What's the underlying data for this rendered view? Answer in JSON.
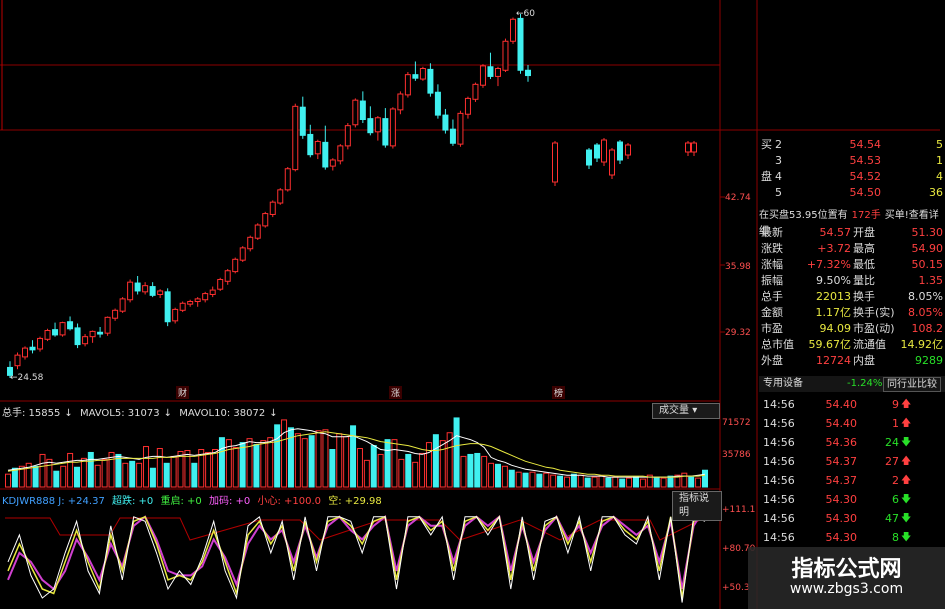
{
  "chart_labels": {
    "peak_price": "60",
    "low_price": "24.58",
    "axis_prices": [
      "42.74",
      "35.98",
      "29.32"
    ],
    "markers": [
      "财",
      "涨",
      "榜"
    ]
  },
  "volume_panel": {
    "header": [
      "总手: 15855",
      "MAVOL5: 31073",
      "MAVOL10: 38072"
    ],
    "button": "成交量",
    "axis": [
      "71572",
      "35786"
    ]
  },
  "indicator_panel": {
    "name": "KDJWR888 J: +24.37",
    "items": [
      "超跌: +0",
      "重启: +0",
      "加码: +0",
      "小心: +100.0",
      "空: +29.98"
    ],
    "button": "指标说明",
    "axis": [
      "+111.1",
      "+80.70",
      "+50.3"
    ]
  },
  "order_book": [
    {
      "side": "买",
      "level": "2",
      "price": "54.54",
      "vol": "5"
    },
    {
      "side": "",
      "level": "3",
      "price": "54.53",
      "vol": "1"
    },
    {
      "side": "盘",
      "level": "4",
      "price": "54.52",
      "vol": "4"
    },
    {
      "side": "",
      "level": "5",
      "price": "54.50",
      "vol": "36"
    }
  ],
  "info_bar": {
    "left": "在买盘53.95位置有",
    "mid": "172手",
    "right": "买单!查看详细"
  },
  "quote": [
    {
      "l1": "最新",
      "v1": "54.57",
      "l2": "开盘",
      "v2": "51.30"
    },
    {
      "l1": "涨跌",
      "v1": "+3.72",
      "l2": "最高",
      "v2": "54.90"
    },
    {
      "l1": "涨幅",
      "v1": "+7.32%",
      "l2": "最低",
      "v2": "50.15"
    },
    {
      "l1": "振幅",
      "v1": "9.50%",
      "l2": "量比",
      "v2": "1.35"
    },
    {
      "l1": "总手",
      "v1": "22013",
      "l2": "换手",
      "v2": "8.05%"
    },
    {
      "l1": "金额",
      "v1": "1.17亿",
      "l2": "换手(实)",
      "v2": "8.05%"
    },
    {
      "l1": "市盈",
      "v1": "94.09",
      "l2": "市盈(动)",
      "v2": "108.2"
    },
    {
      "l1": "总市值",
      "v1": "59.67亿",
      "l2": "流通值",
      "v2": "14.92亿"
    },
    {
      "l1": "外盘",
      "v1": "12724",
      "l2": "内盘",
      "v2": "9289"
    }
  ],
  "sector_bar": {
    "name": "专用设备",
    "change": "-1.24%",
    "button": "同行业比较"
  },
  "ticks": [
    {
      "time": "14:56",
      "price": "54.40",
      "vol": "9",
      "dir": "up"
    },
    {
      "time": "14:56",
      "price": "54.40",
      "vol": "1",
      "dir": "up"
    },
    {
      "time": "14:56",
      "price": "54.36",
      "vol": "24",
      "dir": "down"
    },
    {
      "time": "14:56",
      "price": "54.37",
      "vol": "27",
      "dir": "up"
    },
    {
      "time": "14:56",
      "price": "54.37",
      "vol": "2",
      "dir": "up"
    },
    {
      "time": "14:56",
      "price": "54.30",
      "vol": "6",
      "dir": "down"
    },
    {
      "time": "14:56",
      "price": "54.30",
      "vol": "47",
      "dir": "down"
    },
    {
      "time": "14:56",
      "price": "54.30",
      "vol": "8",
      "dir": "down"
    }
  ],
  "watermark": {
    "title": "指标公式网",
    "url": "www.zbgs3.com"
  },
  "colors": {
    "up": "#ff3030",
    "down": "#40f0f0",
    "grid": "#8b0000",
    "white": "#ffffff",
    "yellow": "#e8e840",
    "magenta": "#d040d0"
  },
  "chart_data": {
    "type": "candlestick",
    "x_label": "",
    "y_label": "",
    "candles": [
      [
        25.8,
        26.5,
        24.6,
        24.9
      ],
      [
        26.0,
        27.5,
        25.6,
        27.2
      ],
      [
        27.0,
        28.2,
        26.7,
        28.0
      ],
      [
        28.1,
        28.9,
        27.4,
        27.8
      ],
      [
        27.9,
        29.3,
        27.6,
        29.1
      ],
      [
        29.0,
        30.2,
        28.8,
        30.0
      ],
      [
        30.1,
        30.9,
        29.3,
        29.5
      ],
      [
        29.5,
        31.0,
        29.3,
        30.9
      ],
      [
        31.0,
        31.6,
        30.0,
        30.2
      ],
      [
        30.3,
        30.8,
        28.0,
        28.4
      ],
      [
        28.5,
        29.6,
        28.2,
        29.3
      ],
      [
        29.3,
        30.0,
        28.6,
        29.9
      ],
      [
        29.8,
        30.4,
        29.2,
        29.6
      ],
      [
        29.7,
        31.6,
        29.4,
        31.5
      ],
      [
        31.4,
        32.5,
        31.1,
        32.3
      ],
      [
        32.2,
        33.8,
        32.0,
        33.6
      ],
      [
        33.5,
        35.8,
        33.2,
        35.5
      ],
      [
        35.4,
        36.2,
        34.1,
        34.5
      ],
      [
        34.4,
        35.5,
        34.1,
        35.1
      ],
      [
        35.0,
        35.5,
        33.8,
        34.0
      ],
      [
        34.1,
        34.7,
        33.7,
        34.5
      ],
      [
        34.4,
        34.8,
        30.5,
        31.0
      ],
      [
        31.1,
        32.6,
        30.8,
        32.4
      ],
      [
        32.3,
        33.3,
        32.1,
        33.1
      ],
      [
        33.0,
        33.5,
        32.7,
        33.3
      ],
      [
        33.3,
        33.8,
        32.7,
        33.6
      ],
      [
        33.5,
        34.4,
        33.2,
        34.2
      ],
      [
        34.1,
        35.0,
        33.8,
        34.6
      ],
      [
        34.7,
        36.0,
        34.5,
        35.8
      ],
      [
        35.6,
        37.0,
        35.2,
        36.8
      ],
      [
        36.7,
        38.3,
        36.5,
        38.1
      ],
      [
        38.0,
        39.6,
        37.8,
        39.4
      ],
      [
        39.3,
        40.8,
        39.0,
        40.6
      ],
      [
        40.5,
        42.2,
        40.3,
        42.0
      ],
      [
        41.9,
        43.5,
        41.7,
        43.3
      ],
      [
        43.2,
        44.8,
        42.9,
        44.6
      ],
      [
        44.5,
        46.2,
        44.3,
        46.0
      ],
      [
        46.0,
        48.6,
        45.8,
        48.4
      ],
      [
        48.3,
        55.8,
        48.1,
        55.5
      ],
      [
        55.4,
        56.6,
        51.8,
        52.2
      ],
      [
        52.3,
        53.4,
        49.7,
        50.0
      ],
      [
        50.1,
        51.7,
        49.5,
        51.5
      ],
      [
        51.4,
        53.3,
        48.3,
        48.6
      ],
      [
        48.7,
        49.6,
        48.2,
        49.4
      ],
      [
        49.3,
        51.2,
        48.9,
        51.0
      ],
      [
        51.0,
        53.6,
        50.6,
        53.3
      ],
      [
        53.4,
        56.4,
        53.1,
        56.2
      ],
      [
        56.1,
        57.2,
        53.6,
        54.0
      ],
      [
        54.1,
        55.5,
        52.2,
        52.5
      ],
      [
        52.6,
        54.4,
        51.6,
        54.2
      ],
      [
        54.1,
        55.3,
        50.8,
        51.1
      ],
      [
        51.0,
        55.4,
        50.7,
        55.2
      ],
      [
        55.1,
        57.2,
        54.6,
        56.9
      ],
      [
        56.8,
        59.4,
        56.5,
        59.1
      ],
      [
        59.1,
        60.6,
        58.4,
        58.7
      ],
      [
        58.6,
        60.0,
        58.4,
        59.8
      ],
      [
        59.7,
        60.4,
        56.6,
        57.0
      ],
      [
        57.1,
        58.0,
        54.1,
        54.5
      ],
      [
        54.5,
        55.2,
        52.4,
        52.8
      ],
      [
        52.9,
        54.0,
        51.0,
        51.3
      ],
      [
        51.2,
        55.0,
        50.9,
        54.7
      ],
      [
        54.6,
        56.6,
        54.1,
        56.4
      ],
      [
        56.3,
        58.2,
        56.0,
        58.0
      ],
      [
        57.9,
        60.3,
        57.6,
        60.1
      ],
      [
        60.0,
        61.6,
        58.6,
        58.9
      ],
      [
        58.9,
        60.0,
        57.8,
        59.8
      ],
      [
        59.6,
        63.2,
        59.4,
        62.9
      ],
      [
        62.9,
        65.6,
        62.6,
        65.4
      ],
      [
        65.5,
        66.0,
        59.2,
        59.6
      ],
      [
        59.6,
        60.2,
        58.3,
        59.0
      ]
    ],
    "volume": [
      13,
      19,
      21,
      24,
      21,
      33,
      28,
      16,
      21,
      34,
      20,
      29,
      35,
      22,
      28,
      35,
      33,
      24,
      26,
      24,
      41,
      19,
      39,
      24,
      31,
      36,
      37,
      24,
      38,
      35,
      38,
      50,
      48,
      40,
      45,
      49,
      43,
      47,
      50,
      63,
      68,
      60,
      54,
      49,
      52,
      57,
      58,
      38,
      54,
      51,
      62,
      39,
      27,
      42,
      33,
      48,
      48,
      28,
      33,
      25,
      34,
      45,
      53,
      47,
      55,
      70,
      31,
      33,
      34,
      31,
      24,
      23,
      21,
      17,
      15,
      14,
      15,
      13,
      14,
      12,
      11,
      10,
      13,
      12,
      9,
      10,
      11,
      9,
      10,
      8,
      9,
      10,
      8,
      12,
      10,
      9,
      11,
      12,
      14,
      10,
      9,
      17
    ],
    "volume_colors": [
      "r",
      "c",
      "r",
      "r",
      "c",
      "r",
      "r",
      "c",
      "r",
      "r",
      "c",
      "r",
      "c",
      "r",
      "r",
      "r",
      "c",
      "r",
      "c",
      "r",
      "r",
      "c",
      "r",
      "c",
      "r",
      "r",
      "r",
      "c",
      "r",
      "r",
      "r",
      "c",
      "r",
      "r",
      "c",
      "r",
      "c",
      "r",
      "r",
      "c",
      "r",
      "c",
      "r",
      "r",
      "c",
      "r",
      "r",
      "c",
      "r",
      "r",
      "c",
      "r",
      "r",
      "c",
      "r",
      "c",
      "r",
      "r",
      "c",
      "r",
      "r",
      "r",
      "c",
      "r",
      "r",
      "c",
      "r",
      "c",
      "c",
      "r",
      "r",
      "c",
      "r",
      "c",
      "r",
      "c",
      "r",
      "c",
      "r",
      "r",
      "c",
      "r",
      "c",
      "r",
      "c",
      "r",
      "r",
      "c",
      "r",
      "c",
      "r",
      "c",
      "r",
      "r",
      "c",
      "r",
      "c",
      "r",
      "r",
      "c",
      "r",
      "c"
    ],
    "mavol5": [
      17,
      18,
      19,
      20,
      22,
      24,
      25,
      24,
      25,
      26,
      27,
      27,
      28,
      28,
      29,
      30,
      31,
      30,
      29,
      28,
      30,
      31,
      31,
      30,
      31,
      32,
      33,
      32,
      33,
      34,
      35,
      39,
      41,
      42,
      44,
      46,
      45,
      45,
      46,
      49,
      55,
      58,
      59,
      58,
      57,
      55,
      54,
      51,
      51,
      51,
      52,
      49,
      46,
      42,
      38,
      37,
      38,
      37,
      36,
      34,
      33,
      35,
      39,
      43,
      47,
      52,
      50,
      48,
      45,
      40,
      30,
      27,
      25,
      22,
      20,
      18,
      17,
      16,
      15,
      14,
      13,
      12,
      12,
      12,
      11,
      11,
      11,
      10,
      10,
      10,
      10,
      10,
      10,
      10,
      10,
      10,
      10,
      11,
      11,
      11,
      12,
      13
    ],
    "mavol10": [
      16,
      17,
      18,
      19,
      20,
      21,
      22,
      23,
      24,
      25,
      25,
      26,
      26,
      27,
      27,
      28,
      29,
      29,
      29,
      29,
      29,
      29,
      30,
      30,
      30,
      31,
      31,
      31,
      32,
      33,
      34,
      36,
      38,
      39,
      40,
      41,
      43,
      44,
      45,
      46,
      48,
      50,
      52,
      53,
      54,
      55,
      56,
      55,
      54,
      53,
      52,
      51,
      50,
      48,
      46,
      45,
      44,
      43,
      42,
      40,
      38,
      37,
      37,
      38,
      40,
      42,
      43,
      44,
      44,
      43,
      41,
      38,
      35,
      32,
      29,
      26,
      24,
      22,
      20,
      19,
      17,
      16,
      15,
      14,
      13,
      13,
      12,
      12,
      11,
      11,
      11,
      11,
      11,
      10,
      10,
      10,
      10,
      10,
      11,
      11,
      11,
      12
    ],
    "kdj_white": [
      50,
      80,
      35,
      10,
      20,
      60,
      95,
      40,
      15,
      90,
      30,
      100,
      95,
      60,
      20,
      40,
      25,
      55,
      95,
      40,
      10,
      90,
      100,
      60,
      95,
      30,
      100,
      40,
      100,
      100,
      95,
      60,
      100,
      100,
      20,
      100,
      100,
      80,
      100,
      30,
      100,
      100,
      80,
      100,
      20,
      100,
      30,
      95,
      100,
      60,
      100,
      40,
      100,
      100,
      80,
      70,
      100,
      30,
      100,
      5,
      100,
      95
    ],
    "kdj_yellow": [
      40,
      70,
      45,
      20,
      15,
      50,
      85,
      50,
      20,
      80,
      40,
      95,
      100,
      70,
      30,
      35,
      30,
      50,
      85,
      50,
      15,
      80,
      95,
      70,
      90,
      40,
      95,
      50,
      95,
      100,
      90,
      70,
      95,
      100,
      30,
      95,
      100,
      85,
      95,
      40,
      95,
      100,
      85,
      100,
      30,
      95,
      40,
      90,
      100,
      70,
      95,
      50,
      95,
      100,
      85,
      75,
      95,
      40,
      100,
      10,
      95,
      100
    ],
    "kdj_magenta": [
      30,
      60,
      50,
      30,
      20,
      40,
      75,
      55,
      30,
      70,
      45,
      90,
      100,
      75,
      40,
      35,
      35,
      45,
      75,
      55,
      25,
      70,
      90,
      75,
      85,
      50,
      90,
      55,
      90,
      100,
      85,
      75,
      90,
      100,
      40,
      90,
      100,
      90,
      90,
      50,
      90,
      100,
      90,
      100,
      40,
      90,
      50,
      85,
      100,
      75,
      90,
      60,
      90,
      100,
      90,
      80,
      90,
      50,
      95,
      20,
      90,
      110
    ]
  }
}
